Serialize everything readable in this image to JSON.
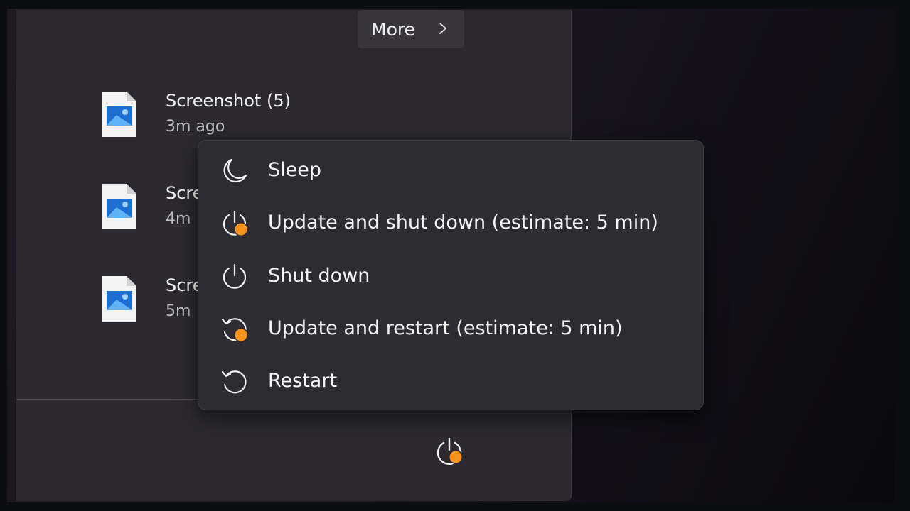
{
  "start_menu": {
    "more_button": {
      "label": "More"
    },
    "recent_items": [
      {
        "title": "Screenshot (5)",
        "time": "3m ago"
      },
      {
        "title": "Scre",
        "time": "4m"
      },
      {
        "title": "Scre",
        "time": "5m"
      }
    ]
  },
  "power_menu": {
    "items": [
      {
        "label": "Sleep",
        "icon": "moon-icon"
      },
      {
        "label": "Update and shut down (estimate: 5 min)",
        "icon": "power-update-icon"
      },
      {
        "label": "Shut down",
        "icon": "power-icon"
      },
      {
        "label": "Update and restart (estimate: 5 min)",
        "icon": "restart-update-icon"
      },
      {
        "label": "Restart",
        "icon": "restart-icon"
      }
    ]
  },
  "colors": {
    "update_badge": "#f7941d",
    "menu_background": "#2d2c32",
    "panel_background": "#2c2a30"
  }
}
